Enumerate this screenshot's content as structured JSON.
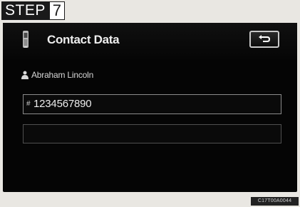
{
  "step": {
    "word": "STEP",
    "number": "7"
  },
  "header": {
    "title": "Contact Data",
    "phone_icon": "phone-icon",
    "back_icon": "back-arrow-icon"
  },
  "contact": {
    "name": "Abraham Lincoln",
    "person_icon": "person-icon"
  },
  "fields": [
    {
      "prefix": "#",
      "value": "1234567890"
    },
    {
      "prefix": "",
      "value": ""
    }
  ],
  "image_code": "C17T00A0044",
  "colors": {
    "screen": "#050505",
    "text": "#eeeeee",
    "field_border": "#8b8b8b",
    "background": "#e9e7e2"
  }
}
